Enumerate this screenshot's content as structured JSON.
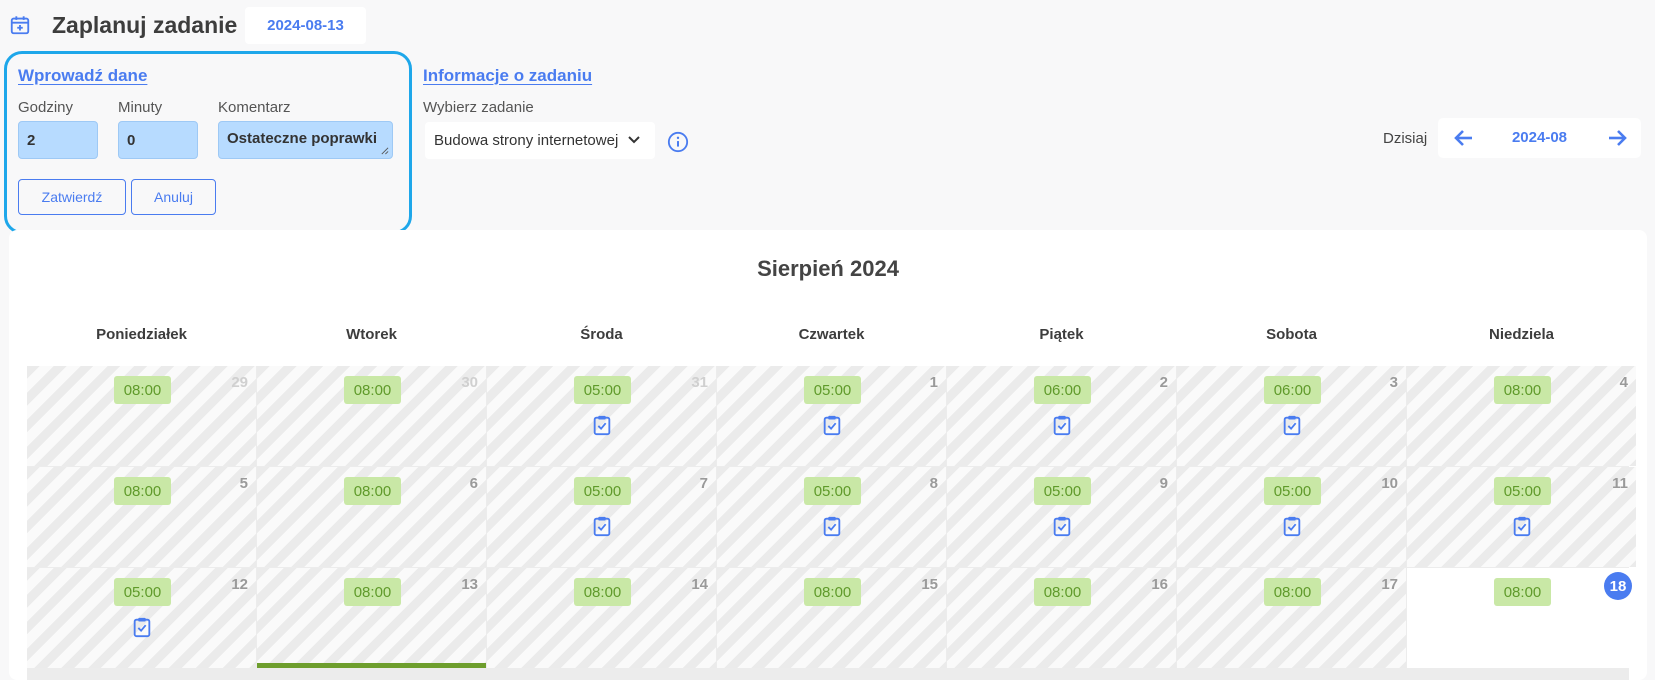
{
  "header": {
    "title": "Zaplanuj zadanie",
    "date": "2024-08-13",
    "icon": "calendar-plus-icon"
  },
  "entry": {
    "heading": "Wprowadź dane",
    "hours_label": "Godziny",
    "hours_value": "2",
    "minutes_label": "Minuty",
    "minutes_value": "0",
    "comment_label": "Komentarz",
    "comment_value": "Ostateczne poprawki",
    "confirm_label": "Zatwierdź",
    "cancel_label": "Anuluj",
    "highlight_color": "#1ea7ea"
  },
  "task_info": {
    "heading": "Informacje o zadaniu",
    "select_label": "Wybierz zadanie",
    "selected_task": "Budowa strony internetowej"
  },
  "month_nav": {
    "today_label": "Dzisiaj",
    "month": "2024-08"
  },
  "calendar": {
    "title": "Sierpień 2024",
    "weekdays": [
      "Poniedziałek",
      "Wtorek",
      "Środa",
      "Czwartek",
      "Piątek",
      "Sobota",
      "Niedziela"
    ],
    "weeks": [
      [
        {
          "day": "29",
          "time": "08:00",
          "outside": true,
          "task": false
        },
        {
          "day": "30",
          "time": "08:00",
          "outside": true,
          "task": false
        },
        {
          "day": "31",
          "time": "05:00",
          "outside": true,
          "task": true
        },
        {
          "day": "1",
          "time": "05:00",
          "outside": false,
          "task": true
        },
        {
          "day": "2",
          "time": "06:00",
          "outside": false,
          "task": true
        },
        {
          "day": "3",
          "time": "06:00",
          "outside": false,
          "task": true
        },
        {
          "day": "4",
          "time": "08:00",
          "outside": false,
          "task": false
        }
      ],
      [
        {
          "day": "5",
          "time": "08:00",
          "outside": false,
          "task": false
        },
        {
          "day": "6",
          "time": "08:00",
          "outside": false,
          "task": false
        },
        {
          "day": "7",
          "time": "05:00",
          "outside": false,
          "task": true
        },
        {
          "day": "8",
          "time": "05:00",
          "outside": false,
          "task": true
        },
        {
          "day": "9",
          "time": "05:00",
          "outside": false,
          "task": true
        },
        {
          "day": "10",
          "time": "05:00",
          "outside": false,
          "task": true
        },
        {
          "day": "11",
          "time": "05:00",
          "outside": false,
          "task": true
        }
      ],
      [
        {
          "day": "12",
          "time": "05:00",
          "outside": false,
          "task": true
        },
        {
          "day": "13",
          "time": "08:00",
          "outside": false,
          "task": false,
          "selected": true
        },
        {
          "day": "14",
          "time": "08:00",
          "outside": false,
          "task": false
        },
        {
          "day": "15",
          "time": "08:00",
          "outside": false,
          "task": false
        },
        {
          "day": "16",
          "time": "08:00",
          "outside": false,
          "task": false
        },
        {
          "day": "17",
          "time": "08:00",
          "outside": false,
          "task": false
        },
        {
          "day": "18",
          "time": "08:00",
          "outside": false,
          "task": false,
          "today": true
        }
      ]
    ]
  },
  "colors": {
    "accent": "#4a7cf0",
    "time_badge_bg": "#c9e8a6",
    "time_badge_text": "#5f9a2a",
    "selected_bar": "#6e9e2d"
  }
}
